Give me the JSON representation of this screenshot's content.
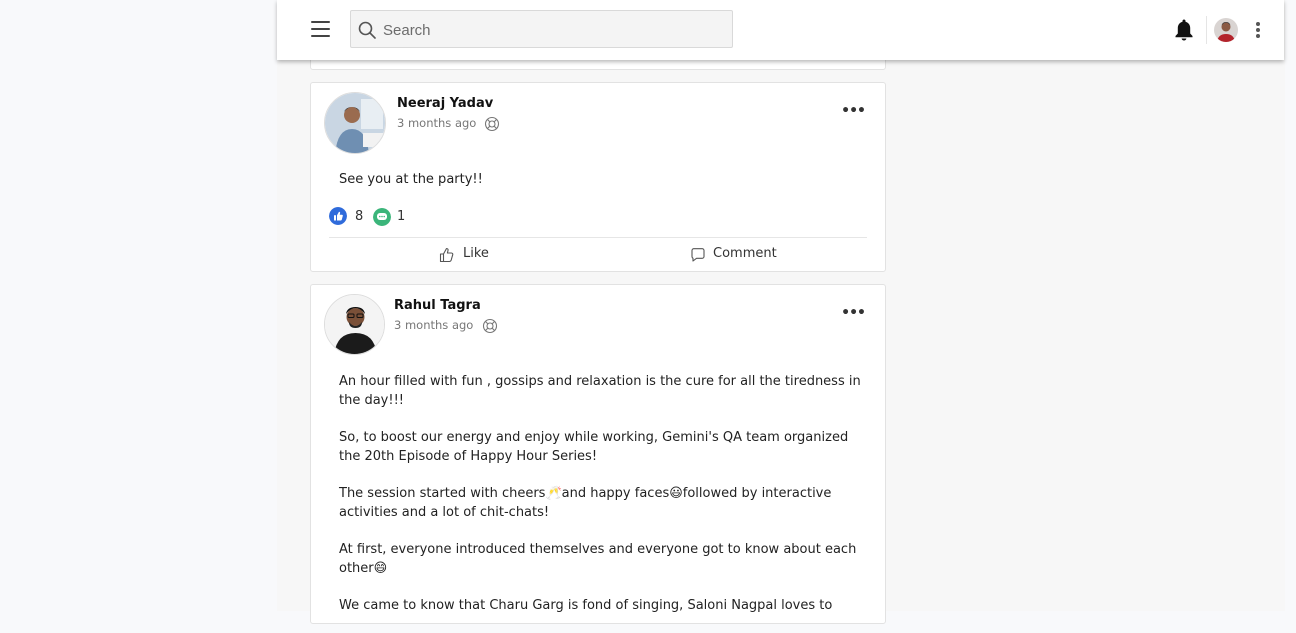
{
  "search": {
    "placeholder": "Search"
  },
  "posts": [
    {
      "author": "Neeraj Yadav",
      "time": "3 months ago",
      "text": "See you at the party!!",
      "likes": "8",
      "comments": "1",
      "like_label": "Like",
      "comment_label": "Comment"
    },
    {
      "author": "Rahul Tagra",
      "time": "3 months ago",
      "paragraphs": [
        "An hour filled with fun , gossips and relaxation is the cure for all the tiredness in the day!!!",
        "So, to boost our energy and enjoy while working, Gemini's QA team organized the 20th Episode of Happy Hour Series!",
        "The session started with cheers🥂and happy faces😃followed by interactive activities and a lot of chit-chats!",
        "At first, everyone introduced themselves and everyone got to know about each other😄",
        "We came to know that Charu Garg is fond of singing, Saloni Nagpal loves to"
      ]
    }
  ],
  "colors": {
    "like_blue": "#2f6bdb",
    "comment_green": "#3bb57a"
  },
  "icons": [
    "menu-icon",
    "search-icon",
    "bell-icon",
    "more-options-icon",
    "globe-icon",
    "like-icon",
    "comment-icon"
  ]
}
